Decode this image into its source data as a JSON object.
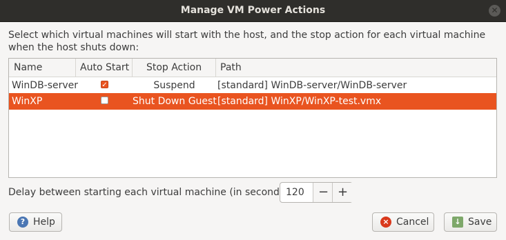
{
  "window": {
    "title": "Manage VM Power Actions",
    "close_icon": "close-icon"
  },
  "instructions": "Select which virtual machines will start with the host, and the stop action for each virtual machine when the host shuts down:",
  "table": {
    "headers": {
      "name": "Name",
      "auto_start": "Auto Start",
      "stop_action": "Stop Action",
      "path": "Path"
    },
    "rows": [
      {
        "name": "WinDB-server",
        "auto_start": true,
        "stop_action": "Suspend",
        "path": "[standard] WinDB-server/WinDB-server",
        "selected": false
      },
      {
        "name": "WinXP",
        "auto_start": false,
        "stop_action": "Shut Down Guest",
        "path": "[standard] WinXP/WinXP-test.vmx",
        "selected": true
      }
    ]
  },
  "delay": {
    "label": "Delay between starting each virtual machine (in seconds):",
    "value": "120",
    "decrement": "−",
    "increment": "+"
  },
  "buttons": {
    "help": "Help",
    "cancel": "Cancel",
    "save": "Save"
  },
  "colors": {
    "accent": "#e95420",
    "titlebar": "#2f2e2b"
  }
}
